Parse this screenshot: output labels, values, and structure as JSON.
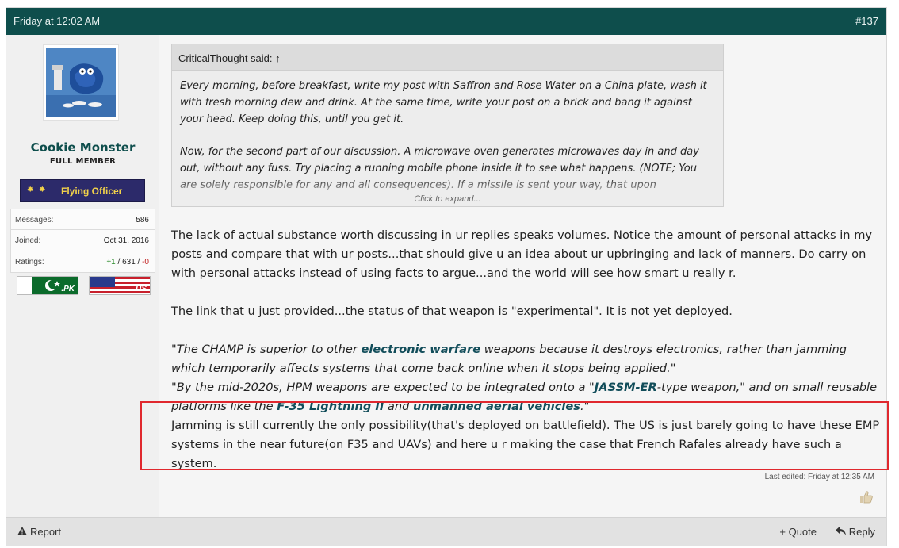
{
  "post": {
    "date": "Friday at 12:02 AM",
    "number": "#137"
  },
  "user": {
    "name": "Cookie Monster",
    "title": "FULL MEMBER",
    "rank_stars": "✸ ✸",
    "rank": "Flying Officer",
    "stats": [
      {
        "label": "Messages:",
        "value": "586"
      },
      {
        "label": "Joined:",
        "value": "Oct 31, 2016"
      }
    ],
    "ratings_label": "Ratings:",
    "ratings_pos": "+1",
    "ratings_mid": " / 631 / ",
    "ratings_neg": "-0",
    "flags": [
      {
        "code": ".PK",
        "icon": "pakistan-flag-icon"
      },
      {
        "code": ".US",
        "icon": "usa-flag-icon"
      }
    ]
  },
  "quote": {
    "author": "CriticalThought said: ↑",
    "para1": "Every morning, before breakfast, write my post with Saffron and Rose Water on a China plate, wash it with fresh morning dew and drink. At the same time, write your post on a brick and bang it against your head. Keep doing this, until you get it.",
    "para2": "Now, for the second part of our discussion. A microwave oven generates microwaves day in and day out, without any fuss. Try placing a running mobile phone inside it to see what happens. (NOTE; You are solely responsible for any and all consequences). If a missile is sent your way, that upon",
    "expand": "Click to expand..."
  },
  "body": {
    "p1": "The lack of actual substance worth discussing in ur replies speaks volumes. Notice the amount of personal attacks in my posts and compare that with ur posts...that should give u an idea about ur upbringing and lack of manners. Do carry on with personal attacks instead of using facts to argue...and the world will see how smart u really r.",
    "p2": "The link that u just provided...the status of that weapon is \"experimental\". It is not yet deployed.",
    "q1_a": "\"The CHAMP is superior to other ",
    "q1_link": "electronic warfare",
    "q1_b": " weapons because it destroys electronics, rather than jamming which temporarily affects systems that come back online when it stops being applied.\"",
    "q2_a": "\"By the mid-2020s, HPM weapons are expected to be integrated onto a \"",
    "q2_link1": "JASSM-ER",
    "q2_b": "-type weapon,\" and on small reusable platforms like the ",
    "q2_link2": "F-35 Lightning II",
    "q2_c": " and ",
    "q2_link3": "unmanned aerial vehicles",
    "q2_d": ".\"",
    "p3": "Jamming is still currently the only possibility(that's deployed on battlefield). The US is just barely going to have these EMP systems in the near future(on F35 and UAVs) and here u r making the case that French Rafales already have such a system."
  },
  "edited": "Last edited: Friday at 12:35 AM",
  "footer": {
    "report_icon": "warning-icon",
    "report": "Report",
    "quote": "+ Quote",
    "reply_icon": "reply-arrow-icon",
    "reply": "Reply"
  },
  "colors": {
    "header_bg": "#0e4e4c",
    "link": "#124d5a",
    "highlight": "#e0282e"
  }
}
